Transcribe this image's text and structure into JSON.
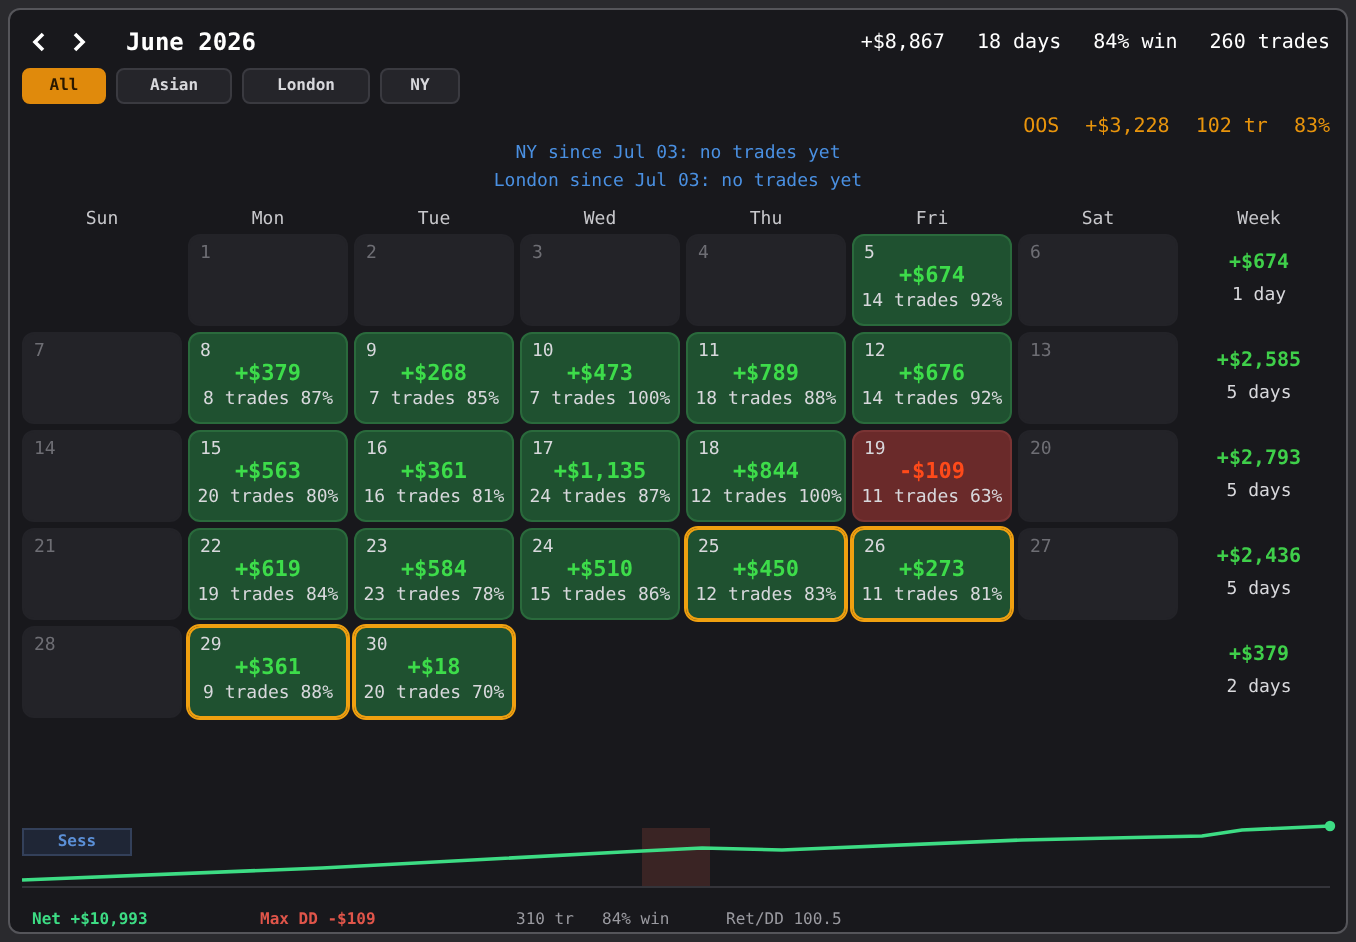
{
  "header": {
    "month": "June 2026",
    "summary": [
      "+$8,867",
      "18 days",
      "84% win",
      "260 trades"
    ]
  },
  "sessions": [
    {
      "label": "All",
      "selected": true
    },
    {
      "label": "Asian",
      "selected": false
    },
    {
      "label": "London",
      "selected": false
    },
    {
      "label": "NY",
      "selected": false
    }
  ],
  "oos": [
    "OOS",
    "+$3,228",
    "102 tr",
    "83%"
  ],
  "notes": [
    "NY since Jul 03: no trades yet",
    "London since Jul 03: no trades yet"
  ],
  "weekdays": [
    "Sun",
    "Mon",
    "Tue",
    "Wed",
    "Thu",
    "Fri",
    "Sat",
    "Week"
  ],
  "weeks": [
    {
      "days": [
        {
          "kind": "none"
        },
        {
          "day": "1",
          "kind": "empty",
          "outlined": false
        },
        {
          "day": "2",
          "kind": "empty",
          "outlined": false
        },
        {
          "day": "3",
          "kind": "empty",
          "outlined": false
        },
        {
          "day": "4",
          "kind": "empty",
          "outlined": false
        },
        {
          "day": "5",
          "kind": "win",
          "pnl": "+$674",
          "stats": "14 trades 92%",
          "outlined": false
        },
        {
          "day": "6",
          "kind": "empty",
          "outlined": false
        }
      ],
      "total": "+$674",
      "count": "1 day"
    },
    {
      "days": [
        {
          "day": "7",
          "kind": "empty",
          "outlined": false
        },
        {
          "day": "8",
          "kind": "win",
          "pnl": "+$379",
          "stats": "8 trades 87%",
          "outlined": false
        },
        {
          "day": "9",
          "kind": "win",
          "pnl": "+$268",
          "stats": "7 trades 85%",
          "outlined": false
        },
        {
          "day": "10",
          "kind": "win",
          "pnl": "+$473",
          "stats": "7 trades 100%",
          "outlined": false
        },
        {
          "day": "11",
          "kind": "win",
          "pnl": "+$789",
          "stats": "18 trades 88%",
          "outlined": false
        },
        {
          "day": "12",
          "kind": "win",
          "pnl": "+$676",
          "stats": "14 trades 92%",
          "outlined": false
        },
        {
          "day": "13",
          "kind": "empty",
          "outlined": false
        }
      ],
      "total": "+$2,585",
      "count": "5 days"
    },
    {
      "days": [
        {
          "day": "14",
          "kind": "empty",
          "outlined": false
        },
        {
          "day": "15",
          "kind": "win",
          "pnl": "+$563",
          "stats": "20 trades 80%",
          "outlined": false
        },
        {
          "day": "16",
          "kind": "win",
          "pnl": "+$361",
          "stats": "16 trades 81%",
          "outlined": false
        },
        {
          "day": "17",
          "kind": "win",
          "pnl": "+$1,135",
          "stats": "24 trades 87%",
          "outlined": false
        },
        {
          "day": "18",
          "kind": "win",
          "pnl": "+$844",
          "stats": "12 trades 100%",
          "outlined": false
        },
        {
          "day": "19",
          "kind": "loss",
          "pnl": "-$109",
          "stats": "11 trades 63%",
          "outlined": false
        },
        {
          "day": "20",
          "kind": "empty",
          "outlined": false
        }
      ],
      "total": "+$2,793",
      "count": "5 days"
    },
    {
      "days": [
        {
          "day": "21",
          "kind": "empty",
          "outlined": false
        },
        {
          "day": "22",
          "kind": "win",
          "pnl": "+$619",
          "stats": "19 trades 84%",
          "outlined": false
        },
        {
          "day": "23",
          "kind": "win",
          "pnl": "+$584",
          "stats": "23 trades 78%",
          "outlined": false
        },
        {
          "day": "24",
          "kind": "win",
          "pnl": "+$510",
          "stats": "15 trades 86%",
          "outlined": false
        },
        {
          "day": "25",
          "kind": "win",
          "pnl": "+$450",
          "stats": "12 trades 83%",
          "outlined": true
        },
        {
          "day": "26",
          "kind": "win",
          "pnl": "+$273",
          "stats": "11 trades 81%",
          "outlined": true
        },
        {
          "day": "27",
          "kind": "empty",
          "outlined": false
        }
      ],
      "total": "+$2,436",
      "count": "5 days"
    },
    {
      "days": [
        {
          "day": "28",
          "kind": "empty",
          "outlined": false
        },
        {
          "day": "29",
          "kind": "win",
          "pnl": "+$361",
          "stats": "9 trades 88%",
          "outlined": true
        },
        {
          "day": "30",
          "kind": "win",
          "pnl": "+$18",
          "stats": "20 trades 70%",
          "outlined": true
        },
        {
          "kind": "none"
        },
        {
          "kind": "none"
        },
        {
          "kind": "none"
        },
        {
          "kind": "none"
        }
      ],
      "total": "+$379",
      "count": "2 days"
    }
  ],
  "chart": {
    "toggle": "Sess"
  },
  "footer": {
    "net": "Net +$10,993",
    "max_dd": "Max DD -$109",
    "trades": "310 tr",
    "win": "84% win",
    "ret_dd": "Ret/DD 100.5"
  }
}
